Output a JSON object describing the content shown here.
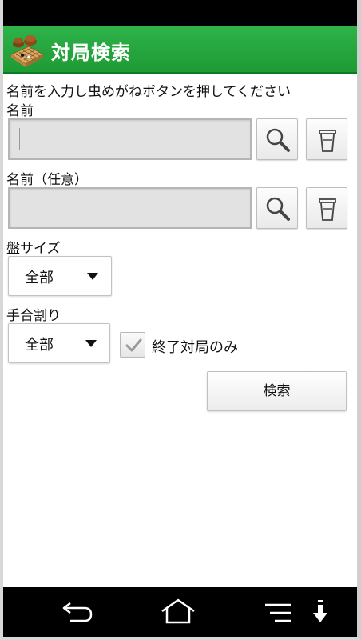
{
  "app_bar": {
    "title": "対局検索",
    "icon": "go-board-icon",
    "color": "#22a63d"
  },
  "form": {
    "instruction": "名前を入力し虫めがねボタンを押してください",
    "name1": {
      "label": "名前",
      "value": "",
      "search_icon": "magnifier-icon",
      "clear_icon": "trash-icon"
    },
    "name2": {
      "label": "名前（任意）",
      "value": "",
      "search_icon": "magnifier-icon",
      "clear_icon": "trash-icon"
    },
    "board_size": {
      "label": "盤サイズ",
      "selected": "全部"
    },
    "handicap": {
      "label": "手合割り",
      "selected": "全部"
    },
    "finished_only": {
      "label": "終了対局のみ",
      "checked": true
    },
    "search_button": "検索"
  },
  "nav_bar": {
    "back_icon": "back-arrow-icon",
    "home_icon": "home-icon",
    "menu_icon": "menu-icon",
    "download_icon": "download-arrow-icon"
  }
}
